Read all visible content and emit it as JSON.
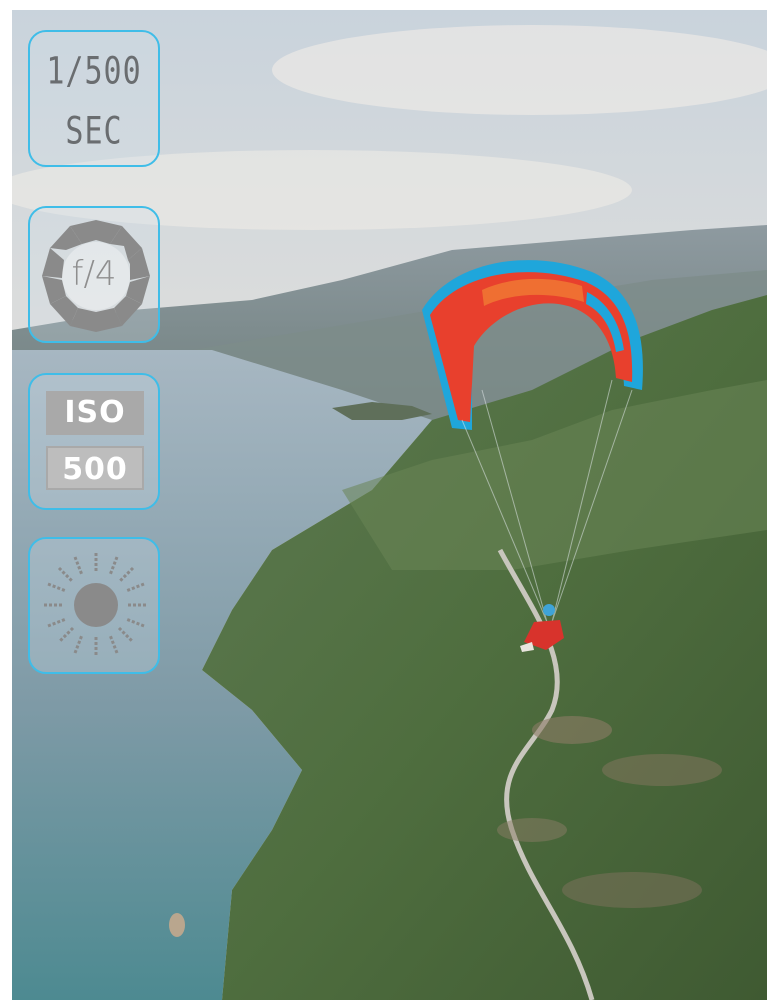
{
  "scene": {
    "subject": "paraglider",
    "canopy_colors": [
      "#e8402d",
      "#1fa6db"
    ]
  },
  "controls": {
    "shutter": {
      "line1": "1/500",
      "line2": "SEC",
      "icon": "shutter-speed-icon"
    },
    "aperture": {
      "value": "f/4",
      "icon": "aperture-icon"
    },
    "iso": {
      "label": "ISO",
      "value": "500",
      "icon": "iso-icon"
    },
    "exposure": {
      "icon": "sun-exposure-icon"
    }
  },
  "colors": {
    "accent": "#3fbde8",
    "icon_gray": "#8a8a8a"
  }
}
